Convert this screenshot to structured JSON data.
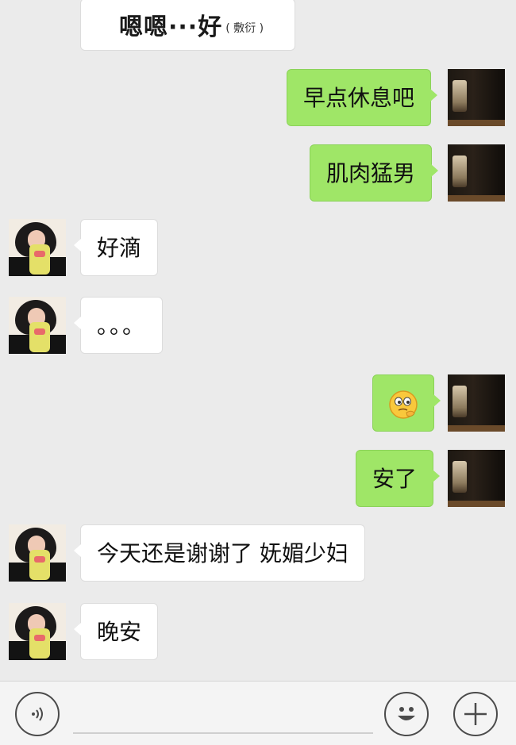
{
  "sticker": {
    "main_text": "嗯嗯···好",
    "sub_text": "( 敷衍 )"
  },
  "messages": [
    {
      "direction": "out",
      "text": "早点休息吧"
    },
    {
      "direction": "out",
      "text": "肌肉猛男"
    },
    {
      "direction": "in",
      "text": "好滴"
    },
    {
      "direction": "in",
      "text": "。。。"
    },
    {
      "direction": "out",
      "emoji": "thinking-emoji-icon"
    },
    {
      "direction": "out",
      "text": "安了"
    },
    {
      "direction": "in",
      "text": "今天还是谢谢了 妩媚少妇"
    },
    {
      "direction": "in",
      "text": "晚安"
    }
  ],
  "input": {
    "value": "",
    "placeholder": ""
  },
  "icons": {
    "voice": "voice-icon",
    "emoji": "emoji-smile-icon",
    "plus": "plus-icon"
  },
  "colors": {
    "outgoing_bubble": "#9fe667",
    "incoming_bubble": "#ffffff",
    "background": "#ebebeb"
  }
}
